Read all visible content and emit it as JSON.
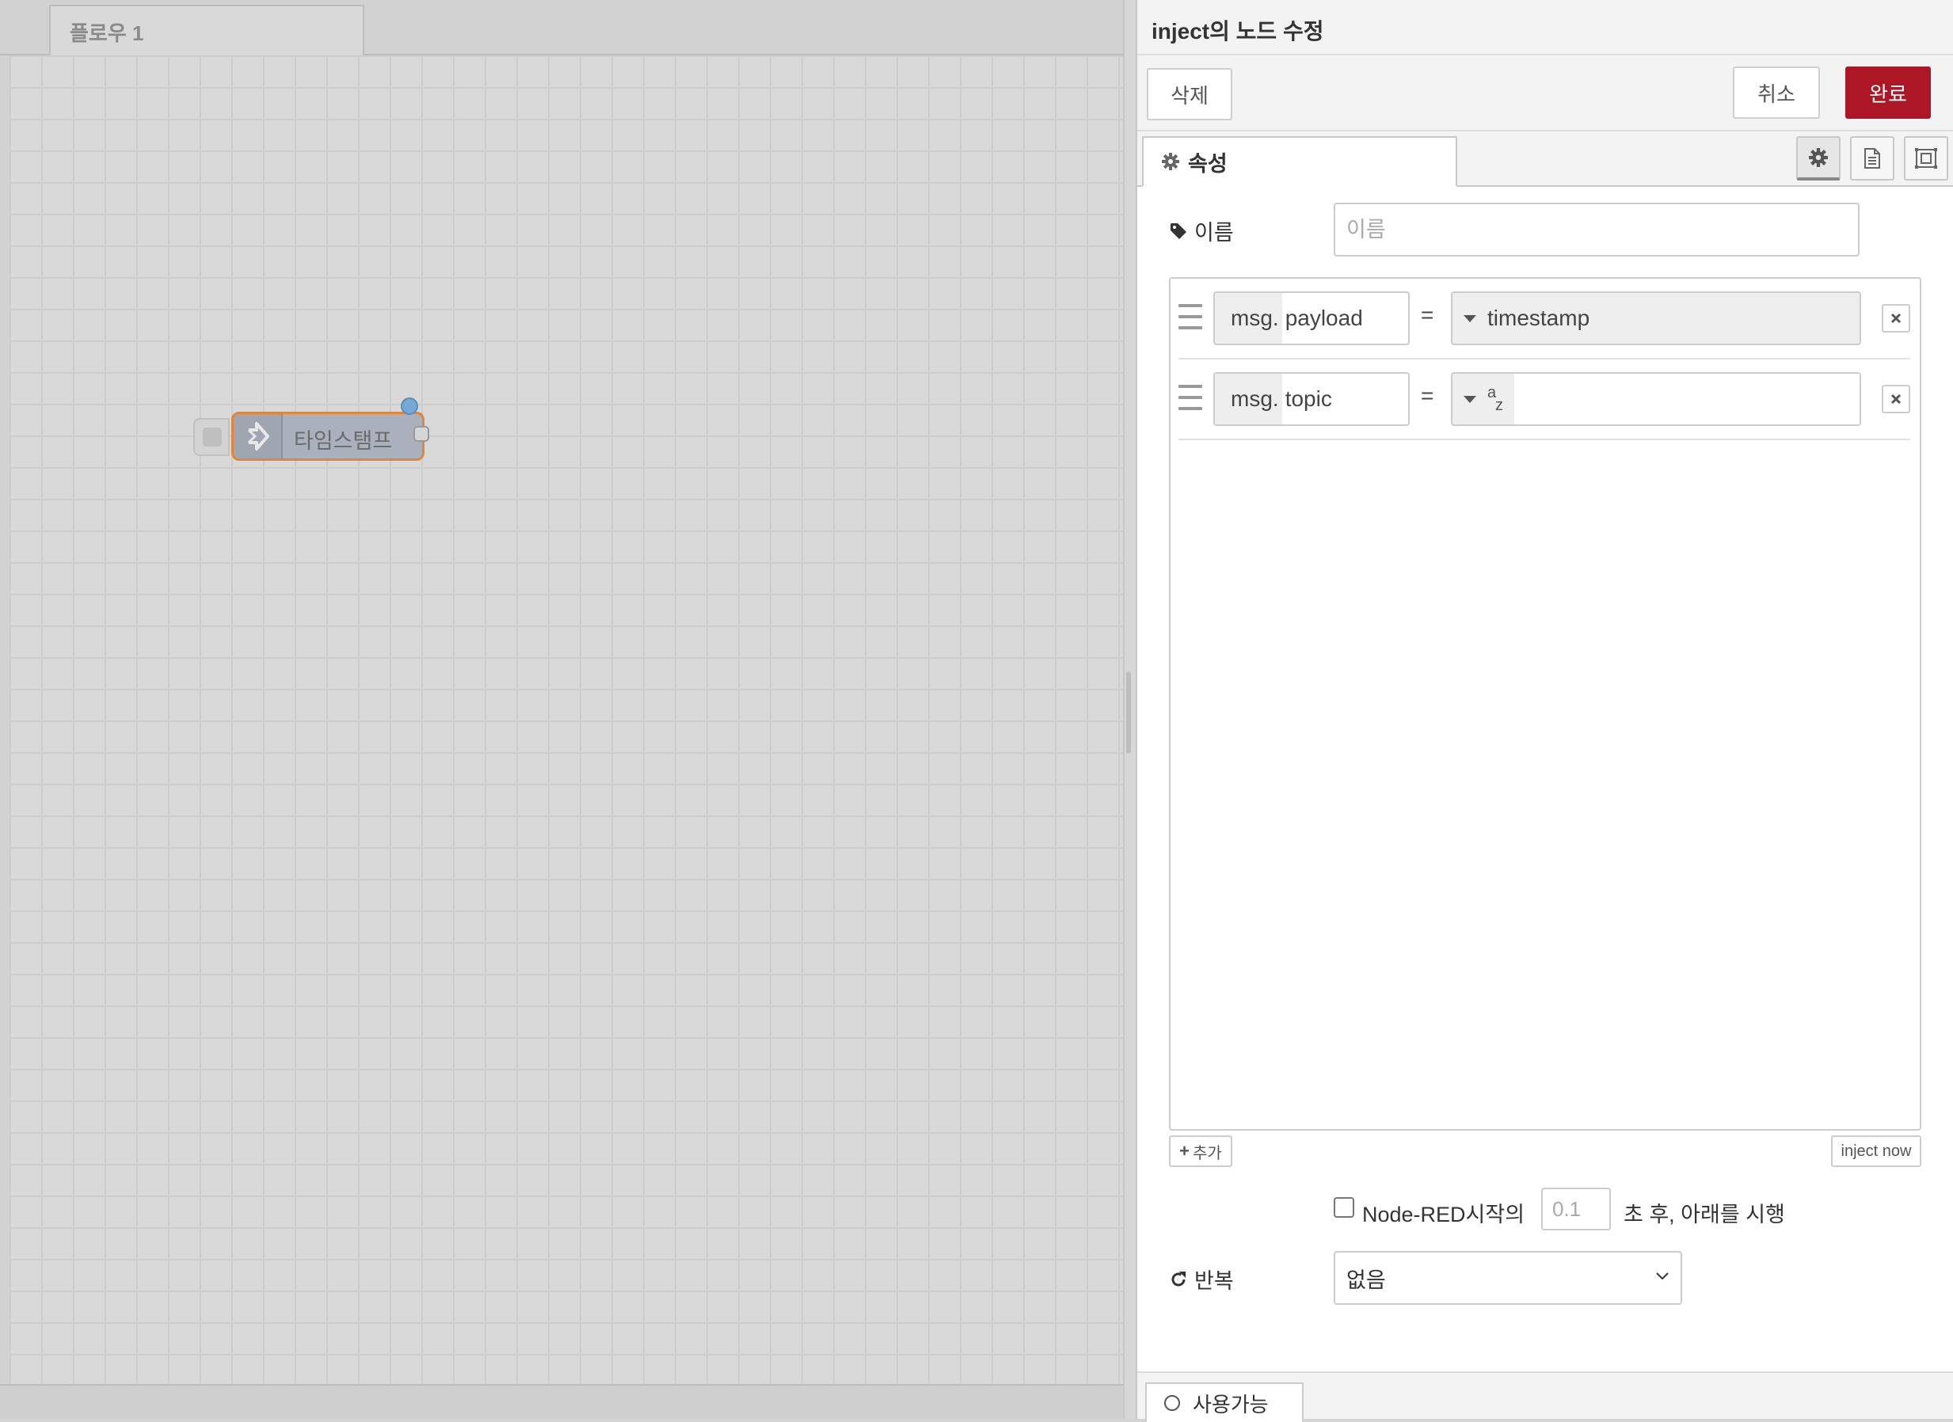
{
  "workspace": {
    "flow_tab_label": "플로우 1",
    "node_label": "타임스탬프"
  },
  "tray": {
    "title": "inject의 노드 수정",
    "delete_label": "삭제",
    "cancel_label": "취소",
    "done_label": "완료",
    "done_color": "#ad1625",
    "properties_tab_label": "속성",
    "name_label": "이름",
    "name_placeholder": "이름",
    "name_value": "",
    "props": [
      {
        "prefix": "msg.",
        "property": "payload",
        "type": "timestamp"
      },
      {
        "prefix": "msg.",
        "property": "topic",
        "type": "az-string",
        "value": ""
      }
    ],
    "type_icon": {
      "a": "a",
      "z": "z"
    },
    "eq_label": "=",
    "add_label": "추가",
    "inject_now_label": "inject now",
    "once_label": "Node-RED시작의",
    "once_delay_placeholder": "0.1",
    "once_suffix": "초 후, 아래를 시행",
    "repeat_label": "반복",
    "repeat_value": "없음",
    "enabled_label": "사용가능"
  },
  "icons": {
    "node": "arrow-in-icon",
    "settings_tab": "gear-icon",
    "description_tab": "file-text-icon",
    "appearance_tab": "object-ungroup-icon",
    "name": "tag-icon",
    "repeat": "repeat-icon"
  }
}
